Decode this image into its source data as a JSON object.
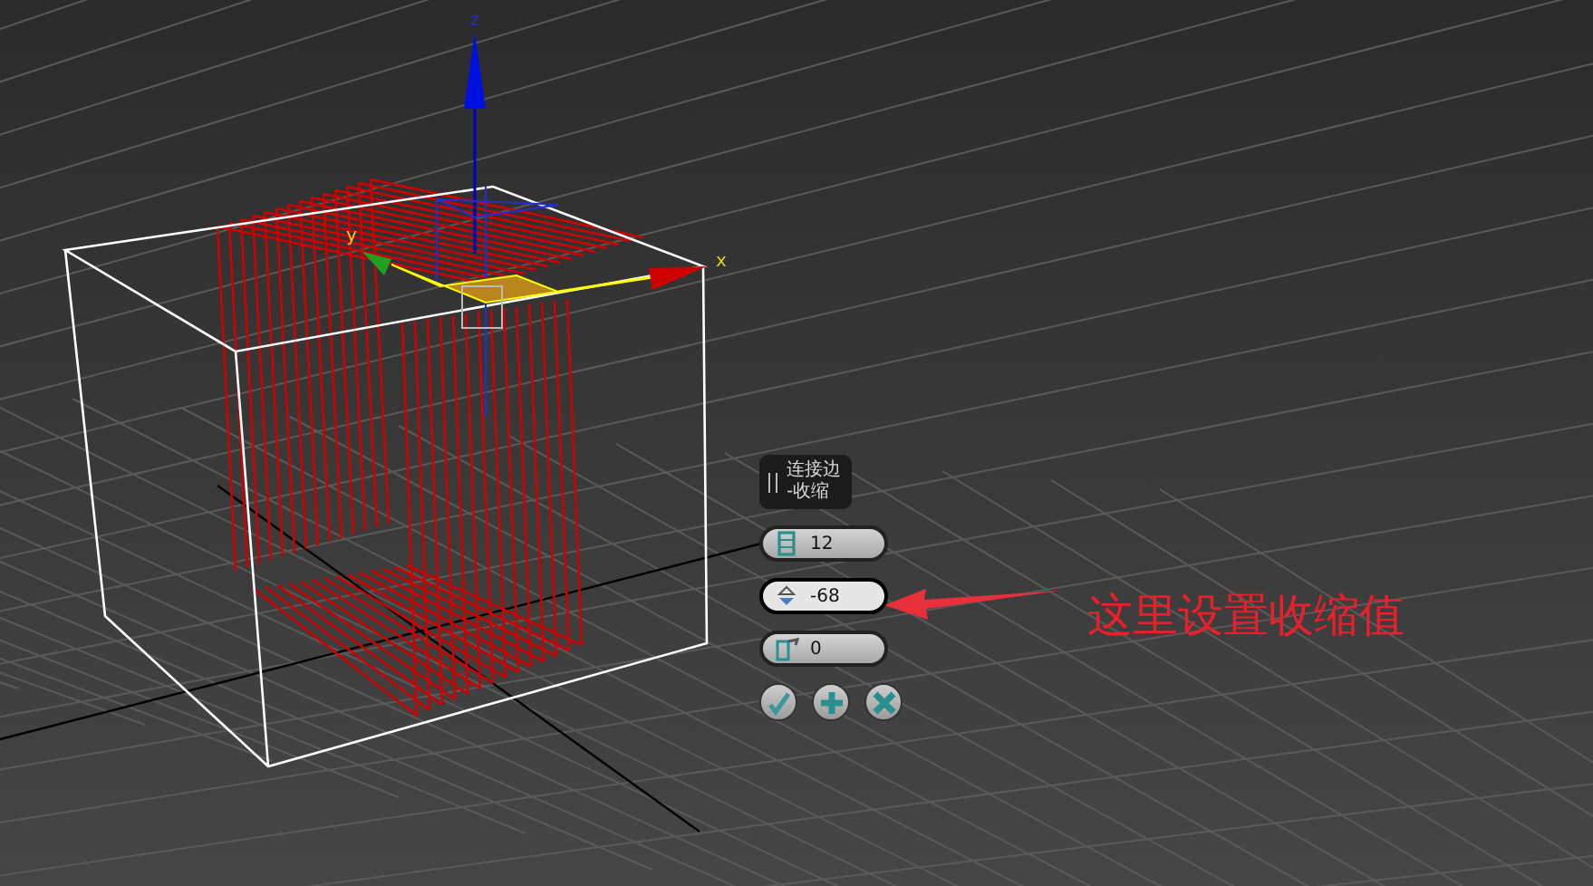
{
  "viewport": {
    "axis_labels": [
      {
        "kind": "z",
        "text": "z"
      },
      {
        "kind": "y",
        "text": "y"
      },
      {
        "kind": "x",
        "text": "x"
      }
    ]
  },
  "caddy": {
    "title_lines": [
      "连接边",
      "-收缩"
    ],
    "fields": [
      {
        "kind": "segments",
        "value": "12",
        "selected": false
      },
      {
        "kind": "pinch",
        "value": "-68",
        "selected": true
      },
      {
        "kind": "slide",
        "value": "0",
        "selected": false
      }
    ],
    "buttons": [
      {
        "kind": "ok"
      },
      {
        "kind": "apply"
      },
      {
        "kind": "cancel"
      }
    ]
  },
  "annotation": {
    "text": "这里设置收缩值"
  }
}
